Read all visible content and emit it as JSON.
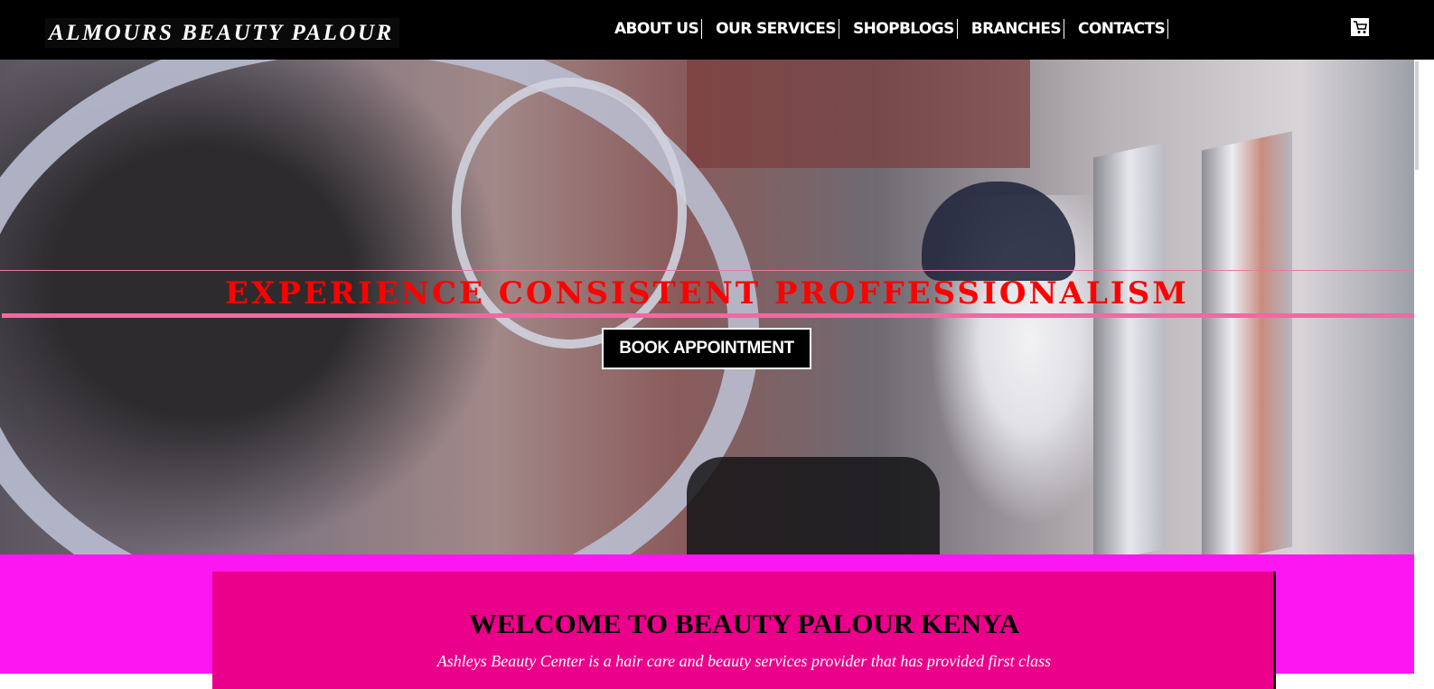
{
  "header": {
    "brand": "ALMOURS BEAUTY PALOUR",
    "nav": [
      "ABOUT US",
      "OUR SERVICES",
      "SHOPBLOGS",
      "BRANCHES",
      "CONTACTS"
    ],
    "cart_icon": "cart-icon"
  },
  "hero": {
    "tagline": "EXPERIENCE CONSISTENT PROFFESSIONALISM",
    "button_label": "BOOK APPOINTMENT",
    "tagline_color": "#ff0000",
    "accent_line_color": "#ee6aa2"
  },
  "welcome": {
    "title": "WELCOME TO BEAUTY PALOUR KENYA",
    "body": "Ashleys Beauty Center is a hair care and beauty services provider that has provided first class",
    "section_color": "#fb16f2",
    "card_color": "#ea008a"
  }
}
